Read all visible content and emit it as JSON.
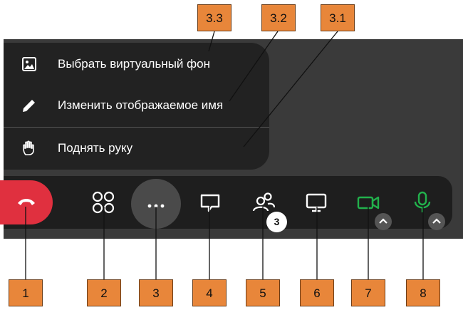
{
  "menu": {
    "items": [
      {
        "label": "Выбрать виртуальный фон",
        "icon": "image-icon"
      },
      {
        "label": "Изменить отображаемое имя",
        "icon": "pencil-icon"
      },
      {
        "label": "Поднять руку",
        "icon": "hand-icon"
      }
    ]
  },
  "toolbar": {
    "buttons": [
      {
        "icon": "phone-hangup-icon",
        "color": "#e0303f"
      },
      {
        "icon": "grid-view-icon"
      },
      {
        "icon": "more-dots-icon"
      },
      {
        "icon": "chat-icon"
      },
      {
        "icon": "participants-icon",
        "badge": "3"
      },
      {
        "icon": "screen-share-icon"
      },
      {
        "icon": "camera-icon",
        "color": "#22b14c"
      },
      {
        "icon": "microphone-icon",
        "color": "#22b14c"
      }
    ]
  },
  "callouts": {
    "bottom": [
      "1",
      "2",
      "3",
      "4",
      "5",
      "6",
      "7",
      "8"
    ],
    "top": [
      "3.3",
      "3.2",
      "3.1"
    ]
  },
  "colors": {
    "callout": "#e8863a",
    "accent_green": "#22b14c",
    "hangup_red": "#e0303f"
  }
}
